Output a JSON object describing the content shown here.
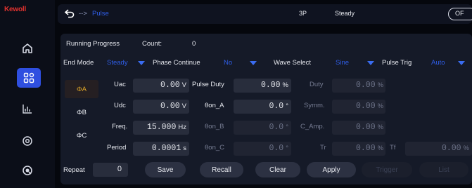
{
  "sidebar": {
    "logo": "Kewoll",
    "items": [
      {
        "icon": "home-icon"
      },
      {
        "icon": "apps-icon",
        "active": true
      },
      {
        "icon": "chart-icon"
      },
      {
        "icon": "target-icon"
      },
      {
        "icon": "power-icon"
      }
    ]
  },
  "topbar": {
    "back_icon": "back-arrow-icon",
    "breadcrumb_arrow": "-->",
    "breadcrumb_page": "Pulse",
    "mode": "3P",
    "state": "Steady",
    "toggle_label": "OF"
  },
  "progress": {
    "label": "Running Progress",
    "count_label": "Count:",
    "count_value": "0"
  },
  "options": {
    "end_mode_label": "End Mode",
    "end_mode_value": "Steady",
    "phase_continue_label": "Phase Continue",
    "phase_continue_value": "No",
    "wave_select_label": "Wave Select",
    "wave_select_value": "Sine",
    "pulse_trig_label": "Pulse Trig",
    "pulse_trig_value": "Auto"
  },
  "phases": [
    "ΦA",
    "ΦB",
    "ΦC"
  ],
  "params": {
    "uac_label": "Uac",
    "uac_value": "0.00",
    "uac_unit": "V",
    "udc_label": "Udc",
    "udc_value": "0.00",
    "udc_unit": "V",
    "freq_label": "Freq.",
    "freq_value": "15.000",
    "freq_unit": "Hz",
    "period_label": "Period",
    "period_value": "0.0001",
    "period_unit": "s",
    "pulse_duty_label": "Pulse Duty",
    "pulse_duty_value": "0.00",
    "pulse_duty_unit": "%",
    "theta_a_label": "θon_A",
    "theta_a_value": "0.0",
    "theta_a_unit": "°",
    "theta_b_label": "θon_B",
    "theta_b_value": "0.0",
    "theta_b_unit": "°",
    "theta_c_label": "θon_C",
    "theta_c_value": "0.0",
    "theta_c_unit": "°",
    "duty_label": "Duty",
    "duty_value": "0.00",
    "duty_unit": "%",
    "symm_label": "Symm.",
    "symm_value": "0.00",
    "symm_unit": "%",
    "camp_label": "C_Amp.",
    "camp_value": "0.00",
    "camp_unit": "%",
    "tr_label": "Tr",
    "tr_value": "0.00",
    "tr_unit": "%",
    "tf_label": "Tf",
    "tf_value": "0.00",
    "tf_unit": "%"
  },
  "footer": {
    "repeat_label": "Repeat",
    "repeat_value": "0",
    "save": "Save",
    "recall": "Recall",
    "clear": "Clear",
    "apply": "Apply",
    "trigger": "Trigger",
    "list": "List"
  }
}
